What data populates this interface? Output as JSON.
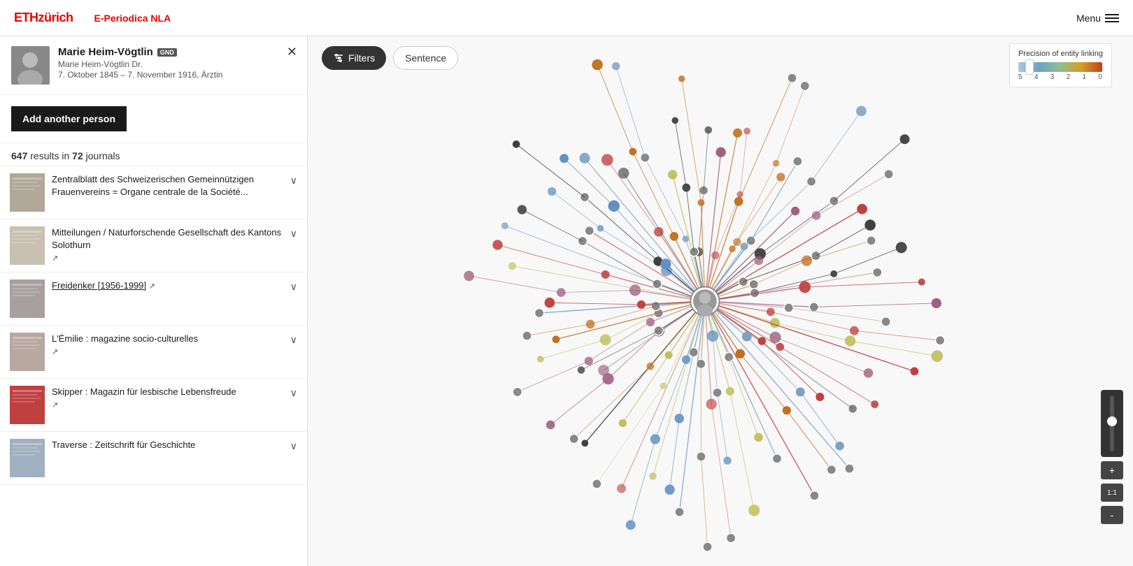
{
  "header": {
    "eth_text": "ETH",
    "zurich_text": "zürich",
    "eperiodica_label": "E-Periodica NLA",
    "menu_label": "Menu"
  },
  "person": {
    "name": "Marie Heim-Vögtlin",
    "badge": "GND",
    "alt_name": "Marie Heim-Vögtlin Dr.",
    "dates": "7. Oktober 1845 – 7. November 1916, Ärztin"
  },
  "add_person_button": "Add another person",
  "results": {
    "count": "647",
    "count_label": "results in",
    "journals_count": "72",
    "journals_label": "journals"
  },
  "filters_button": "Filters",
  "sentence_button": "Sentence",
  "precision_legend": {
    "title": "Precision of entity linking",
    "labels": [
      "5",
      "4",
      "3",
      "2",
      "1",
      "0"
    ]
  },
  "journals": [
    {
      "title": "Zentralblatt des Schweizerischen Gemeinnützigen Frauenvereins = Organe centrale de la Société...",
      "has_link": false,
      "thumb_color": "#b0a898"
    },
    {
      "title": "Mitteilungen / Naturforschende Gesellschaft des Kantons Solothurn",
      "has_link": true,
      "thumb_color": "#c8c0b0"
    },
    {
      "title": "Freidenker [1956-1999]",
      "has_link": true,
      "thumb_color": "#a8a0a0"
    },
    {
      "title": "L'Émilie : magazine socio-culturelles",
      "has_link": true,
      "thumb_color": "#b8a8a0"
    },
    {
      "title": "Skipper : Magazin für lesbische Lebensfreude",
      "has_link": true,
      "thumb_color": "#c04040"
    },
    {
      "title": "Traverse : Zeitschrift für Geschichte",
      "has_link": false,
      "thumb_color": "#a0b0c0"
    }
  ],
  "zoom": {
    "plus_label": "+",
    "ratio_label": "1:1",
    "minus_label": "-"
  }
}
